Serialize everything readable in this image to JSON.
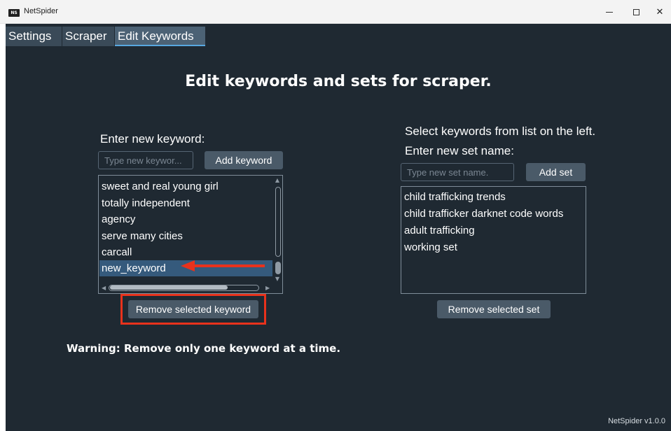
{
  "window": {
    "title": "NetSpider",
    "icon_text": "NS"
  },
  "tabs": [
    {
      "label": "Settings"
    },
    {
      "label": "Scraper"
    },
    {
      "label": "Edit Keywords"
    }
  ],
  "main": {
    "heading": "Edit keywords and sets for scraper.",
    "warning": "Warning: Remove only one keyword at a time.",
    "version": "NetSpider v1.0.0"
  },
  "keywords_panel": {
    "label": "Enter new keyword:",
    "input_placeholder": "Type new keywor...",
    "add_button": "Add keyword",
    "items": [
      "sweet and real young girl",
      "totally independent",
      "agency",
      "serve many cities",
      "carcall",
      "new_keyword"
    ],
    "selected_item": "new_keyword",
    "remove_button": "Remove selected keyword"
  },
  "sets_panel": {
    "instruction": "Select keywords from list on the left.",
    "label": "Enter new set name:",
    "input_placeholder": "Type new set name.",
    "add_button": "Add set",
    "items": [
      "child trafficking trends",
      "child trafficker darknet code words",
      "adult trafficking",
      "working set"
    ],
    "remove_button": "Remove selected set"
  },
  "annotations": {
    "color": "#e8321c"
  }
}
